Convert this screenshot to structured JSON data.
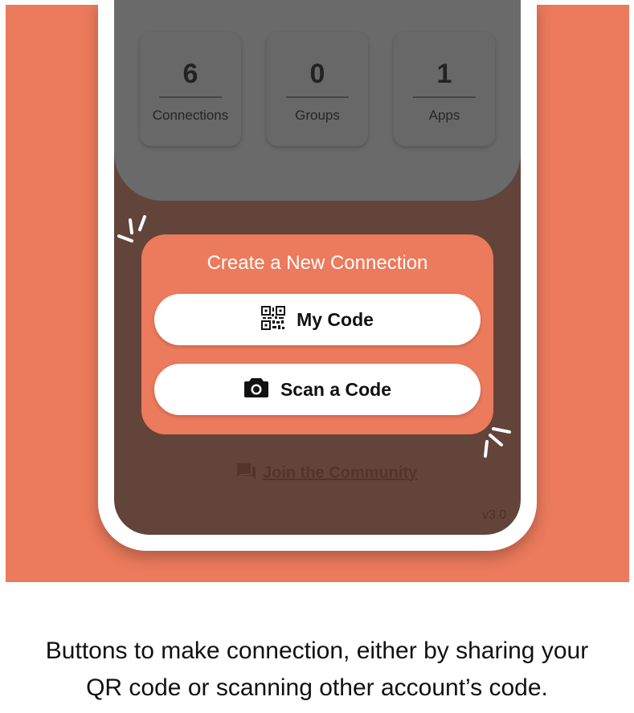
{
  "stats": [
    {
      "value": "6",
      "label": "Connections"
    },
    {
      "value": "0",
      "label": "Groups"
    },
    {
      "value": "1",
      "label": "Apps"
    }
  ],
  "create_card": {
    "title": "Create a New Connection",
    "my_code_label": "My Code",
    "scan_label": "Scan a Code"
  },
  "community": {
    "label": "Join the Community"
  },
  "version": "v3.0",
  "caption": {
    "line1": "Buttons to make connection, either by sharing your",
    "line2": "QR code or scanning other account’s code."
  },
  "icons": {
    "qr": "qr-code-icon",
    "camera": "camera-icon",
    "chat": "chat-bubbles-icon"
  },
  "colors": {
    "accent": "#ec7a5c",
    "screen_background": "#63443a",
    "overlay_gray": "#6a6a6a",
    "button_background": "#ffffff"
  }
}
